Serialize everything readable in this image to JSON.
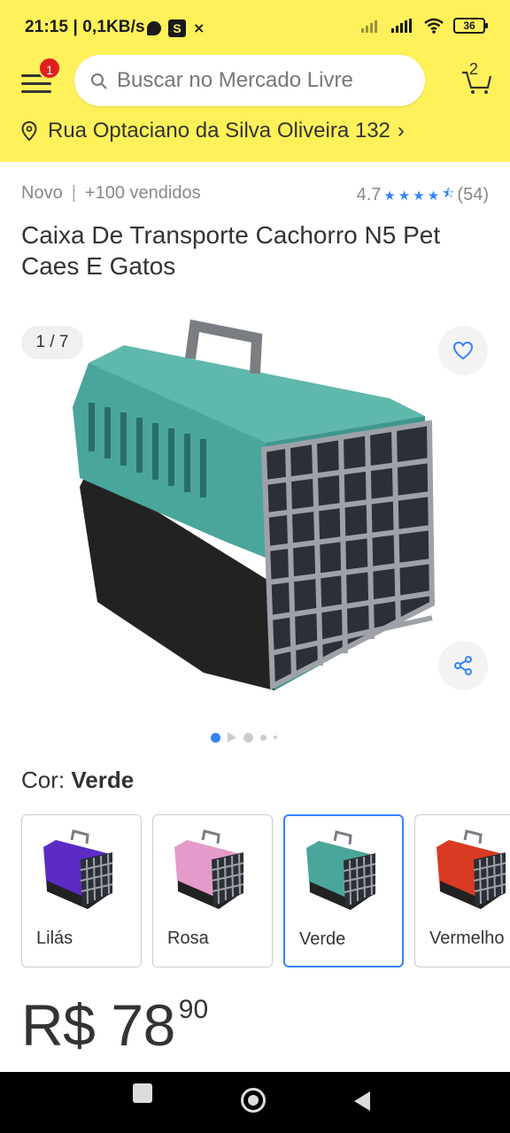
{
  "status_bar": {
    "time": "21:15 | 0,1KB/s",
    "battery": "36"
  },
  "header": {
    "notification_count": "1",
    "search_placeholder": "Buscar no Mercado Livre",
    "cart_count": "2",
    "address": "Rua Optaciano da Silva Oliveira 132"
  },
  "product": {
    "condition": "Novo",
    "sold": "+100 vendidos",
    "rating": "4.7",
    "reviews": "(54)",
    "title": "Caixa De Transporte Cachorro N5 Pet Caes E Gatos",
    "image_counter": "1 / 7",
    "color_label": "Cor:",
    "selected_color": "Verde",
    "variants": [
      {
        "label": "Lilás",
        "color": "#5b2bc4"
      },
      {
        "label": "Rosa",
        "color": "#e49bc9"
      },
      {
        "label": "Verde",
        "color": "#4aa69a"
      },
      {
        "label": "Vermelho",
        "color": "#d83a22"
      }
    ],
    "price_currency": "R$",
    "price_main": "78",
    "price_cents": "90"
  },
  "colors": {
    "brand_yellow": "#fff159",
    "accent_blue": "#3483fa",
    "badge_red": "#e0201e",
    "carrier_teal": "#4aa69a"
  },
  "gallery": {
    "total_dots": 5,
    "active_dot": 1
  }
}
